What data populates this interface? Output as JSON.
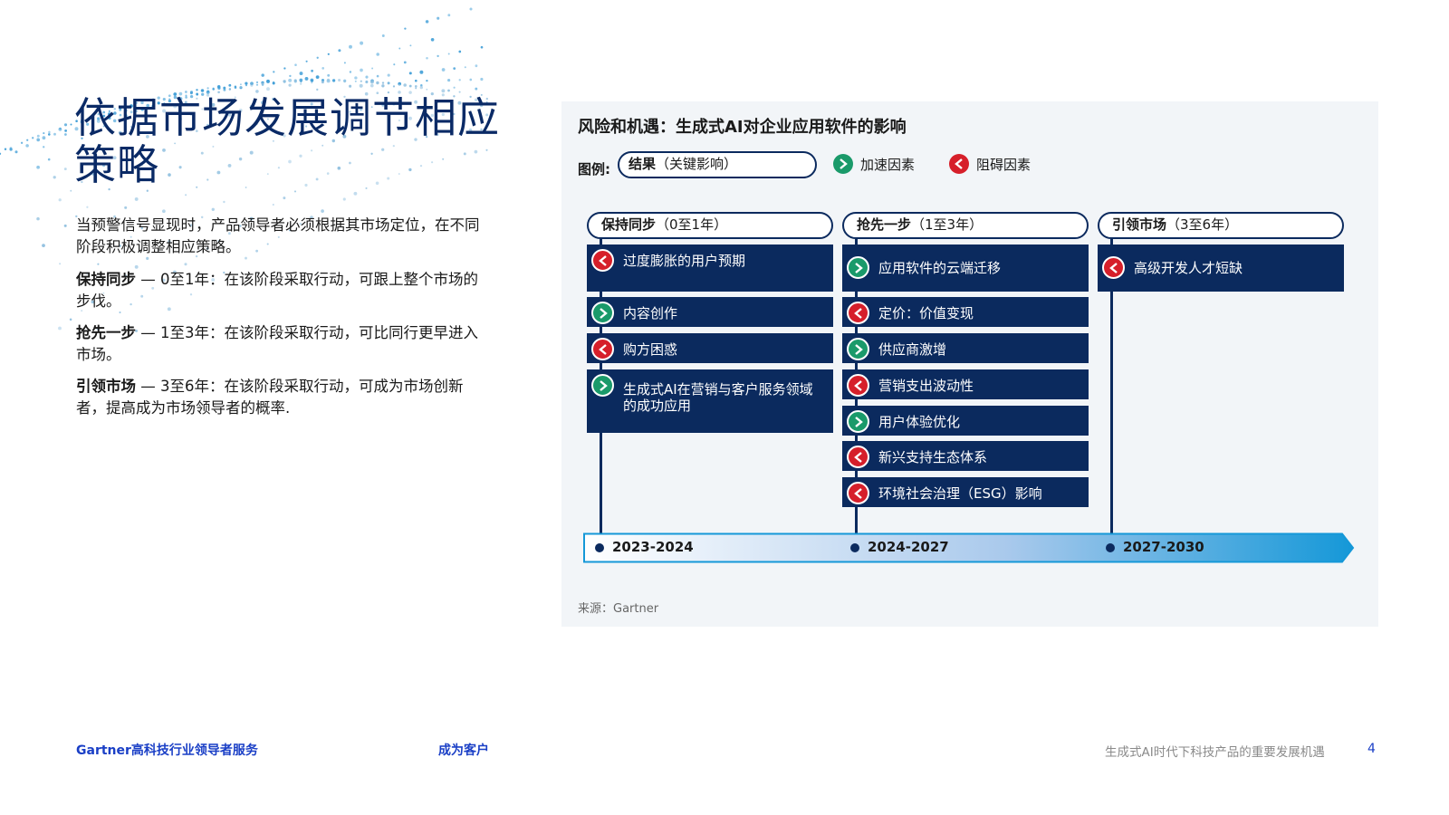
{
  "page": {
    "title": "依据市场发展调节相应策略",
    "intro": "当预警信号显现时，产品领导者必须根据其市场定位，在不同阶段积极调整相应策略。",
    "strategies": [
      {
        "name": "保持同步",
        "text": " — 0至1年：在该阶段采取行动，可跟上整个市场的步伐。"
      },
      {
        "name": "抢先一步",
        "text": " — 1至3年：在该阶段采取行动，可比同行更早进入市场。"
      },
      {
        "name": "引领市场",
        "text": " — 3至6年：在该阶段采取行动，可成为市场创新者，提高成为市场领导者的概率."
      }
    ]
  },
  "panel": {
    "title": "风险和机遇：生成式AI对企业应用软件的影响",
    "legend": {
      "label": "图例:",
      "result_bold": "结果",
      "result_rest": "（关键影响）",
      "accelerator": "加速因素",
      "impediment": "阻碍因素"
    },
    "stages": [
      {
        "name": "保持同步",
        "range": "（0至1年）",
        "year": "2023-2024",
        "items": [
          {
            "type": "impediment",
            "text": "过度膨胀的用户预期"
          },
          {
            "type": "accelerator",
            "text": "内容创作"
          },
          {
            "type": "impediment",
            "text": "购方困惑"
          },
          {
            "type": "accelerator",
            "text": "生成式AI在营销与客户服务领域的成功应用"
          }
        ]
      },
      {
        "name": "抢先一步",
        "range": "（1至3年）",
        "year": "2024-2027",
        "items": [
          {
            "type": "accelerator",
            "text": "应用软件的云端迁移"
          },
          {
            "type": "impediment",
            "text": "定价：价值变现"
          },
          {
            "type": "accelerator",
            "text": "供应商激增"
          },
          {
            "type": "impediment",
            "text": "营销支出波动性"
          },
          {
            "type": "accelerator",
            "text": "用户体验优化"
          },
          {
            "type": "impediment",
            "text": "新兴支持生态体系"
          },
          {
            "type": "impediment",
            "text": "环境社会治理（ESG）影响"
          }
        ]
      },
      {
        "name": "引领市场",
        "range": "（3至6年）",
        "year": "2027-2030",
        "items": [
          {
            "type": "impediment",
            "text": "高级开发人才短缺"
          }
        ]
      }
    ],
    "source": "来源：Gartner"
  },
  "footer": {
    "left": "Gartner高科技行业领导者服务",
    "mid": "成为客户",
    "right": "生成式AI时代下科技产品的重要发展机遇",
    "page": "4"
  },
  "colors": {
    "navy": "#0b2a5e",
    "accelerator": "#1a9a6a",
    "impediment": "#d61f2a",
    "title": "#0a2a66",
    "footer_link": "#1a3fc6"
  }
}
